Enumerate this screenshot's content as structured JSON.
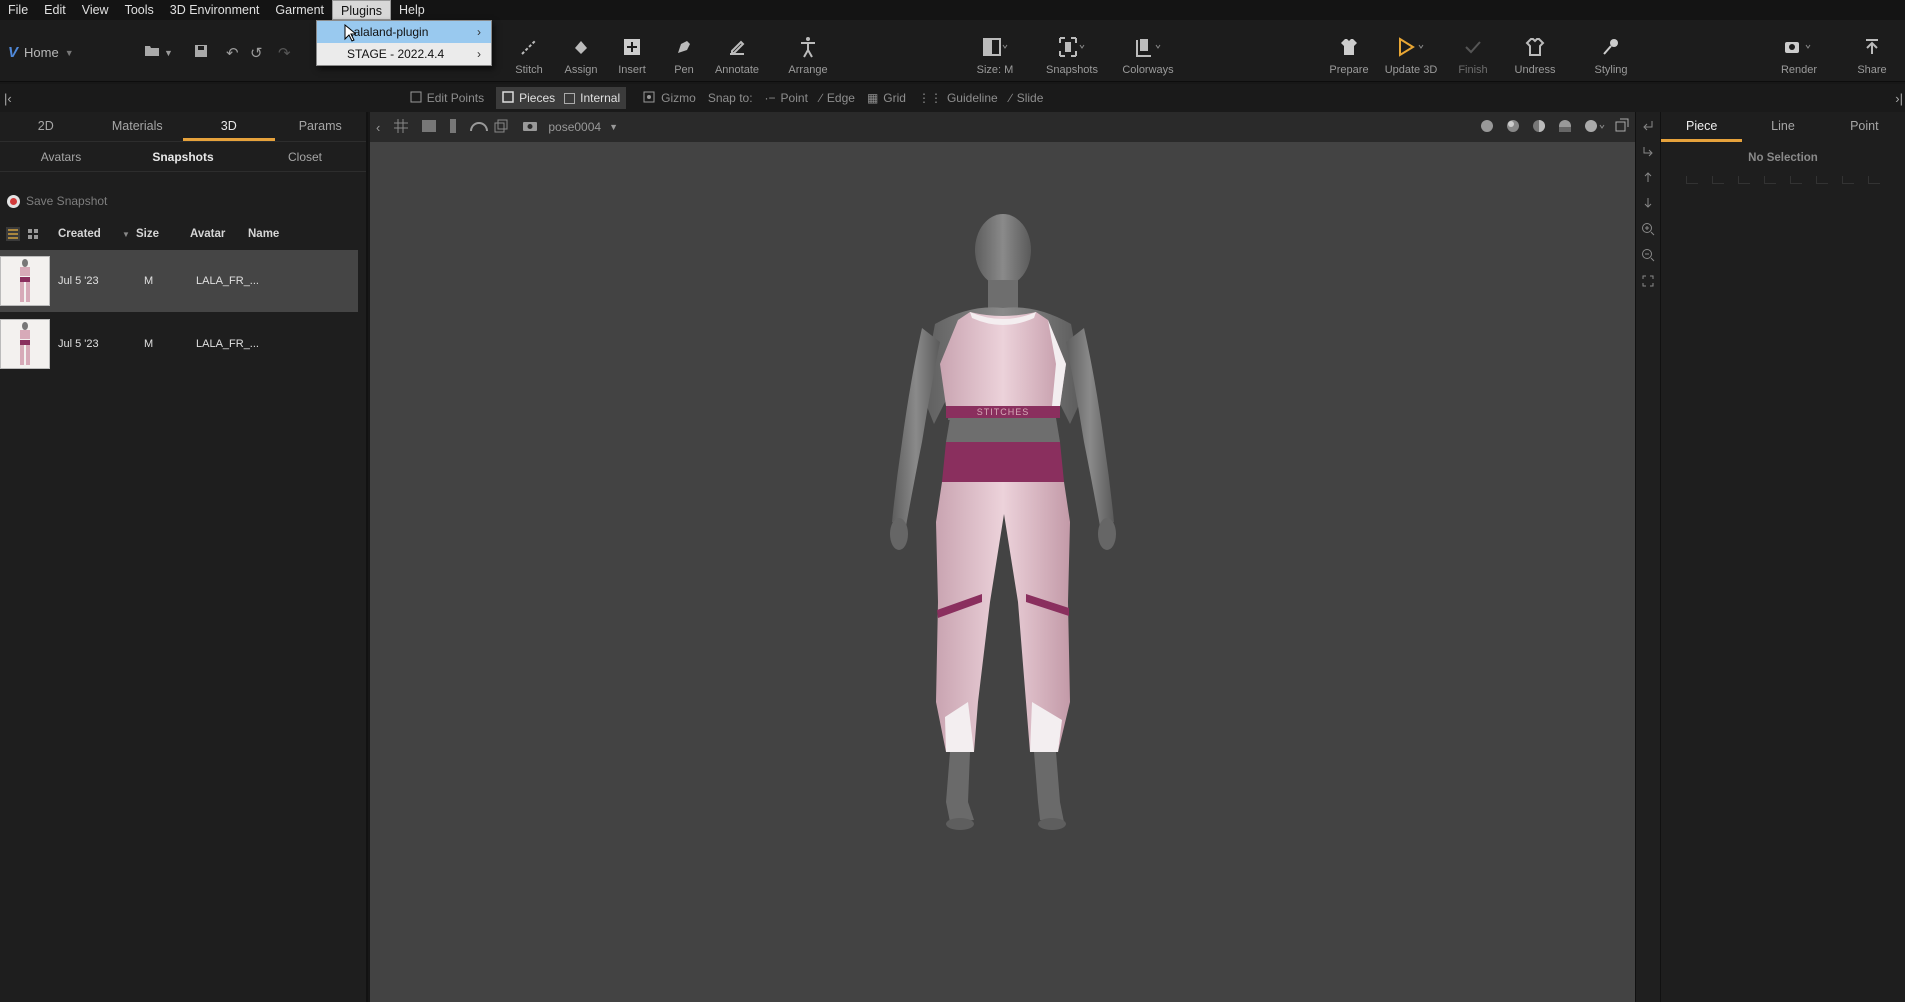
{
  "menu": [
    "File",
    "Edit",
    "View",
    "Tools",
    "3D Environment",
    "Garment",
    "Plugins",
    "Help"
  ],
  "active_menu": "Plugins",
  "plugins_menu": [
    {
      "label": "Lalaland-plugin",
      "highlighted": true
    },
    {
      "label": "STAGE - 2022.4.4",
      "highlighted": false
    }
  ],
  "toolbar": {
    "home": "Home",
    "tools": [
      {
        "label": "Stitch"
      },
      {
        "label": "Assign"
      },
      {
        "label": "Insert"
      },
      {
        "label": "Pen"
      },
      {
        "label": "Annotate"
      },
      {
        "label": "Arrange"
      },
      {
        "label": "Size: M"
      },
      {
        "label": "Snapshots"
      },
      {
        "label": "Colorways"
      },
      {
        "label": "Prepare"
      },
      {
        "label": "Update 3D"
      },
      {
        "label": "Finish"
      },
      {
        "label": "Undress"
      },
      {
        "label": "Styling"
      },
      {
        "label": "Render"
      },
      {
        "label": "Share"
      }
    ]
  },
  "row2": {
    "edit_points": "Edit Points",
    "pieces": "Pieces",
    "internal": "Internal",
    "gizmo": "Gizmo",
    "snap_to": "Snap to:",
    "point": "Point",
    "edge": "Edge",
    "grid": "Grid",
    "guideline": "Guideline",
    "slide": "Slide"
  },
  "left_panel": {
    "tabs": [
      "2D",
      "Materials",
      "3D",
      "Params"
    ],
    "active_tab": "3D",
    "subtabs": [
      "Avatars",
      "Snapshots",
      "Closet"
    ],
    "active_subtab": "Snapshots",
    "save_snapshot": "Save Snapshot",
    "columns": [
      "Created",
      "Size",
      "Avatar",
      "Name"
    ],
    "rows": [
      {
        "created": "Jul 5 '23",
        "size": "M",
        "avatar": "LALA_FR_...",
        "selected": true
      },
      {
        "created": "Jul 5 '23",
        "size": "M",
        "avatar": "LALA_FR_...",
        "selected": false
      }
    ]
  },
  "viewport": {
    "pose": "pose0004",
    "garment_text": "STITCHES"
  },
  "right_panel": {
    "tabs": [
      "Piece",
      "Line",
      "Point"
    ],
    "active_tab": "Piece",
    "status": "No Selection"
  },
  "colors": {
    "accent": "#e6a23c",
    "garment_pink": "#e7c6d0",
    "garment_band": "#8a2f5e",
    "viewport_bg": "#434343"
  }
}
